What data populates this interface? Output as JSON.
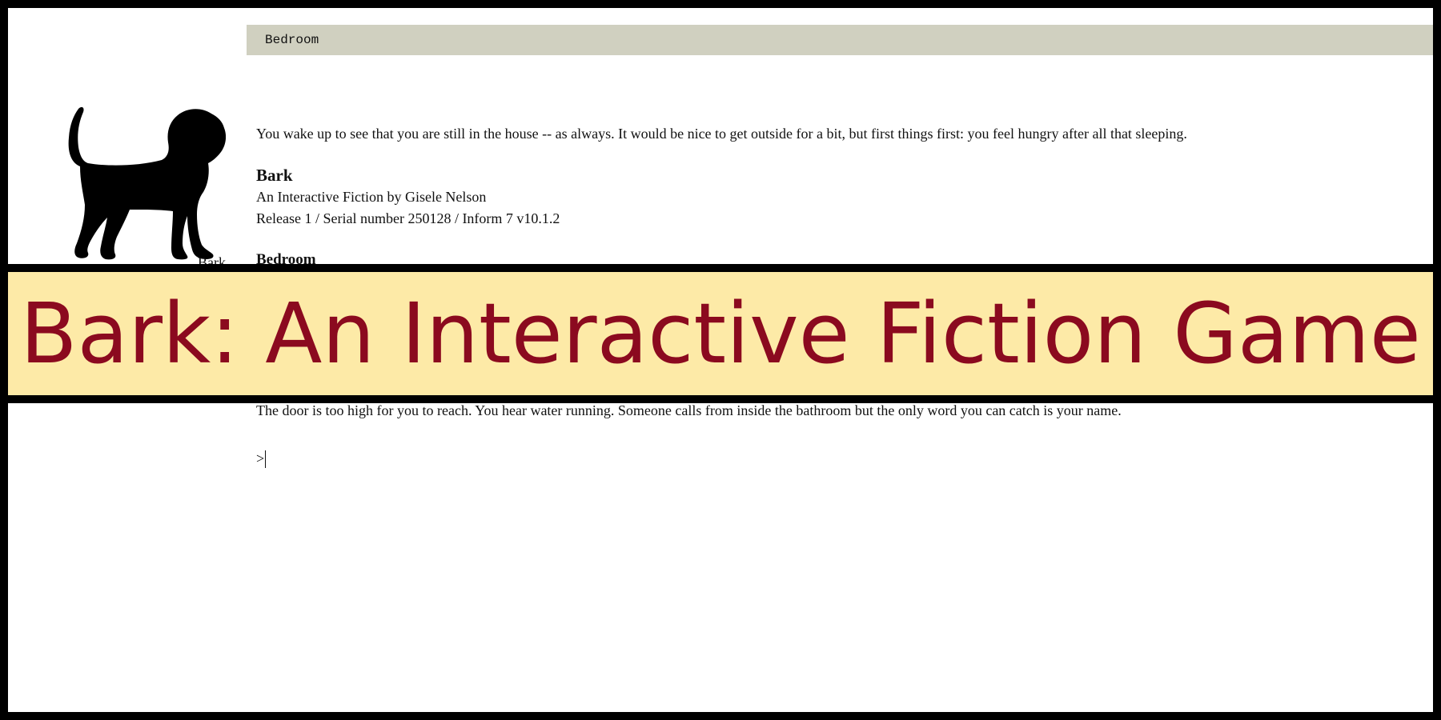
{
  "status_bar": {
    "location": "Bedroom"
  },
  "cover": {
    "image": "dog-silhouette",
    "caption": "Bark"
  },
  "story": {
    "intro": "You wake up to see that you are still in the house -- as always. It would be nice to get outside for a bit, but first things first: you feel hungry after all that sleeping.",
    "title": "Bark",
    "byline": "An Interactive Fiction by Gisele Nelson",
    "release": "Release 1 / Serial number 250128 / Inform 7 v10.1.2",
    "room_heading": "Bedroom",
    "door_text": "The door is too high for you to reach. You hear water running. Someone calls from inside the bathroom but the only word you can catch is your name."
  },
  "prompt": {
    "symbol": ">",
    "value": ""
  },
  "banner": {
    "title": "Bark: An Interactive Fiction Game"
  },
  "colors": {
    "status_bar_bg": "#d0d0c0",
    "banner_bg": "#fdeaa7",
    "banner_text": "#8b0a1f"
  }
}
